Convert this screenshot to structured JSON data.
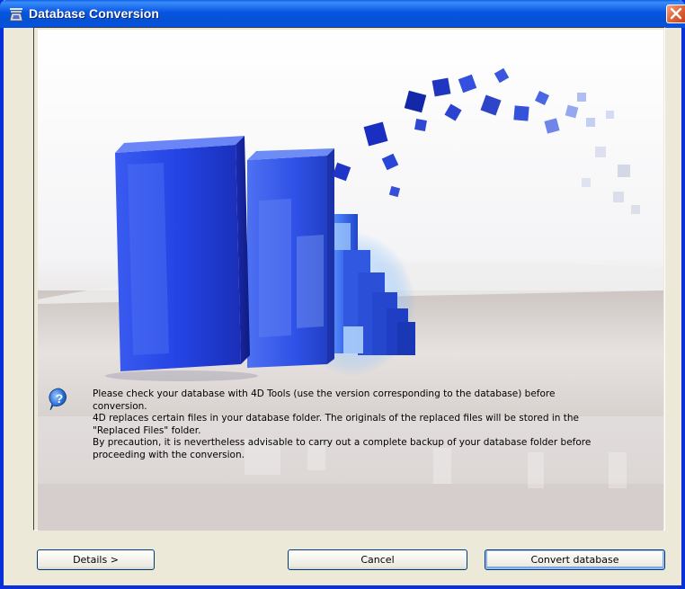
{
  "window": {
    "title": "Database Conversion"
  },
  "message": {
    "lines": [
      "Please check your database with 4D Tools (use the version corresponding to the database) before",
      "conversion.",
      "4D replaces certain files in your database folder. The originals of the replaced files will be stored in the",
      "\"Replaced Files\" folder.",
      "By precaution, it is nevertheless advisable to carry out a complete backup of your database folder before",
      "proceeding with the conversion."
    ],
    "icon": "question-icon"
  },
  "buttons": {
    "details": "Details >",
    "cancel": "Cancel",
    "convert": "Convert database"
  },
  "colors": {
    "titlebar": "#0854e3",
    "window_bg": "#ece9d8",
    "accent_blue": "#1f3ad6"
  }
}
